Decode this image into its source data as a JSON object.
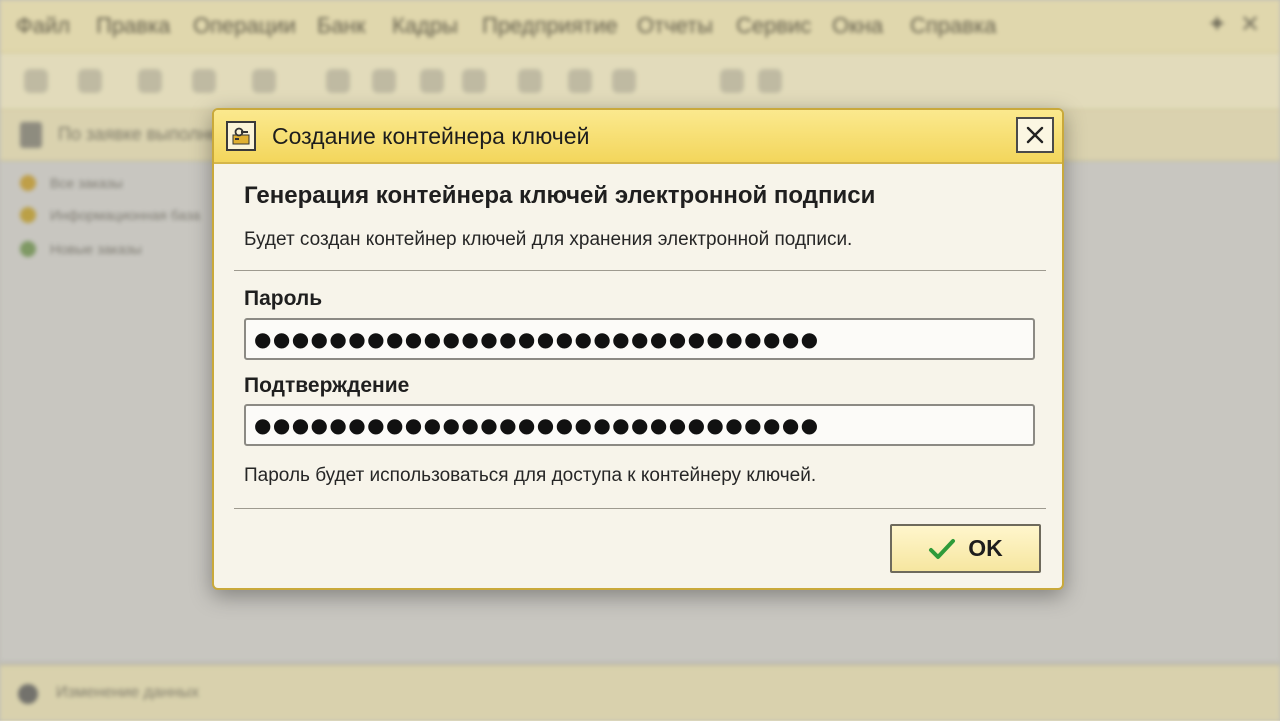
{
  "menubar": {
    "items": [
      "Файл",
      "Правка",
      "Операции",
      "Банк",
      "Кадры",
      "Предприятие",
      "Отчеты",
      "Сервис",
      "Окна",
      "Справка"
    ]
  },
  "panel": {
    "title": "По заявке выполнены"
  },
  "sidebar": {
    "items": [
      "Все заказы",
      "Информационная база",
      "Новые заказы"
    ]
  },
  "statusbar": {
    "text": "Изменение данных"
  },
  "dialog": {
    "title": "Создание контейнера ключей",
    "heading": "Генерация контейнера ключей электронной подписи",
    "description": "Будет создан контейнер ключей для хранения электронной подписи.",
    "password": {
      "label": "Пароль",
      "value": "●●●●●●●●●●●●●●●●●●●●●●●●●●●●●●"
    },
    "confirmation": {
      "label": "Подтверждение",
      "value": "●●●●●●●●●●●●●●●●●●●●●●●●●●●●●●"
    },
    "hint": "Пароль будет использоваться для доступа к контейнеру ключей.",
    "ok_label": "OK"
  },
  "colors": {
    "titlebar": "#f3d65c",
    "dialog_border": "#c9a93b",
    "ok_check": "#2e9b3a",
    "menubar": "#f1e6b5"
  },
  "icons": {
    "title": "key-container-icon",
    "close": "close-icon",
    "ok": "checkmark-icon"
  }
}
